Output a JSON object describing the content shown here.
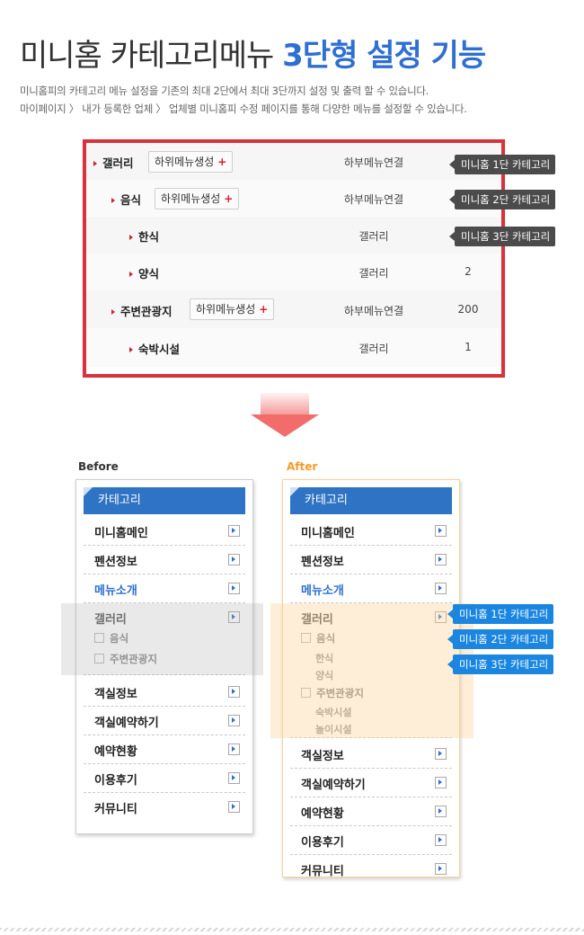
{
  "heading": {
    "title_plain": "미니홈 카테고리메뉴 ",
    "title_highlight": "3단형 설정 기능",
    "desc_line1": "미니홈피의 카테고리 메뉴 설정을 기존의 최대 2단에서 최대 3단까지 설정 및 출력 할 수 있습니다.",
    "desc_line2": "마이페이지 〉 내가 등록한 업체 〉 업체별 미니홈피 수정 페이지를 통해 다양한 메뉴를 설정할 수 있습니다."
  },
  "settings_table": {
    "rows": [
      {
        "name": "갤러리",
        "button": "하위메뉴생성",
        "type": "하부메뉴연결",
        "num": "",
        "tag": "미니홈 1단 카테고리"
      },
      {
        "name": "음식",
        "button": "하위메뉴생성",
        "type": "하부메뉴연결",
        "num": "",
        "tag": "미니홈 2단 카테고리"
      },
      {
        "name": "한식",
        "button": "",
        "type": "갤러리",
        "num": "",
        "tag": "미니홈 3단 카테고리"
      },
      {
        "name": "양식",
        "button": "",
        "type": "갤러리",
        "num": "2",
        "tag": ""
      },
      {
        "name": "주변관광지",
        "button": "하위메뉴생성",
        "type": "하부메뉴연결",
        "num": "200",
        "tag": ""
      },
      {
        "name": "숙박시설",
        "button": "",
        "type": "갤러리",
        "num": "1",
        "tag": ""
      }
    ],
    "plus_symbol": "+"
  },
  "labels": {
    "before": "Before",
    "after": "After"
  },
  "before_menu": {
    "header": "카테고리",
    "items": [
      "미니홈메인",
      "펜션정보",
      "메뉴소개",
      "갤러리",
      "객실정보",
      "객실예약하기",
      "예약현황",
      "이용후기",
      "커뮤니티"
    ],
    "gallery_subs": [
      "음식",
      "주변관광지"
    ]
  },
  "after_menu": {
    "header": "카테고리",
    "items": [
      "미니홈메인",
      "펜션정보",
      "메뉴소개",
      "갤러리",
      "객실정보",
      "객실예약하기",
      "예약현황",
      "이용후기",
      "커뮤니티"
    ],
    "level2": [
      "음식",
      "주변관광지"
    ],
    "level3_food": [
      "한식",
      "양식"
    ],
    "level3_tour": [
      "숙박시설",
      "놀이시설"
    ],
    "tags": [
      "미니홈 1단 카테고리",
      "미니홈 2단 카테고리",
      "미니홈 3단 카테고리"
    ]
  },
  "colors": {
    "accent_blue": "#2f6fd1",
    "table_border": "#d8333c",
    "after_label": "#f79a26",
    "tag_blue": "#1b86e0",
    "tag_dark": "#4b4b4b"
  }
}
